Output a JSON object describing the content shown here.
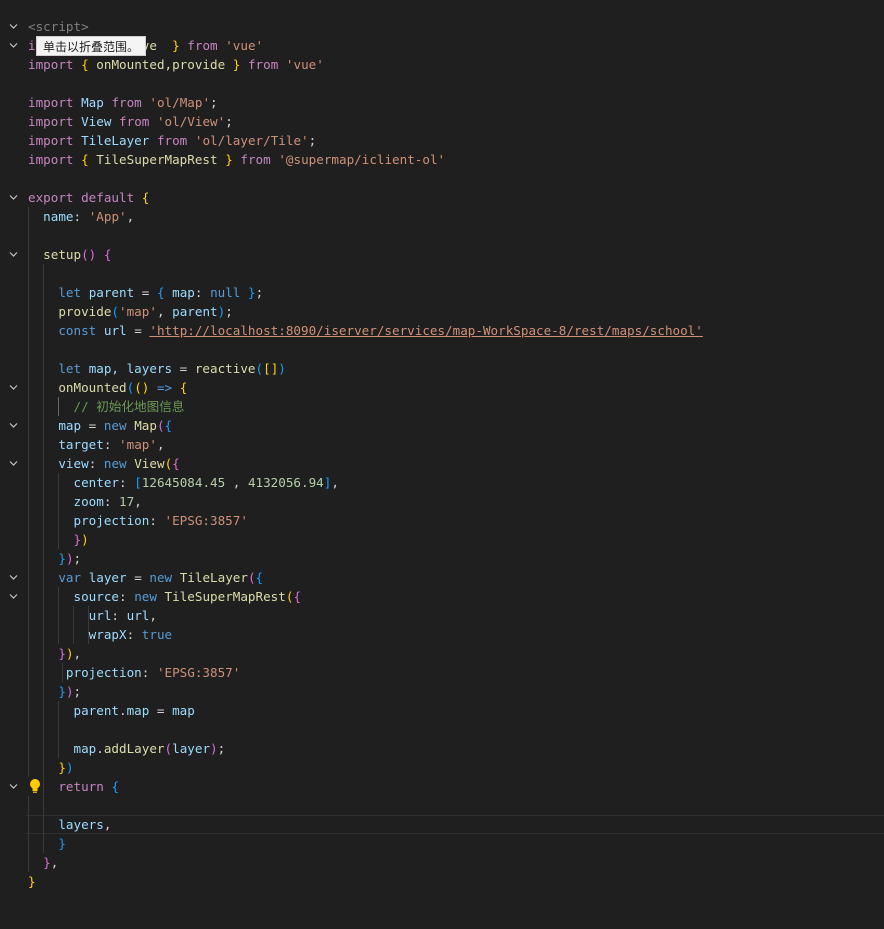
{
  "tooltip": {
    "text": "单击以折叠范围。"
  },
  "code": {
    "l1": {
      "open": "<script>"
    },
    "l2": {
      "kw_import": "i",
      "hidden": "",
      "end": "ve",
      "close": "}",
      "kw_from": "from",
      "str": "'vue'"
    },
    "l3": {
      "kw": "import",
      "open": "{",
      "names": "onMounted,provide",
      "close": "}",
      "kw_from": "from",
      "str": "'vue'"
    },
    "l5": {
      "kw": "import",
      "name": "Map",
      "kw_from": "from",
      "str": "'ol/Map'",
      "semi": ";"
    },
    "l6": {
      "kw": "import",
      "name": "View",
      "kw_from": "from",
      "str": "'ol/View'",
      "semi": ";"
    },
    "l7": {
      "kw": "import",
      "name": "TileLayer",
      "kw_from": "from",
      "str": "'ol/layer/Tile'",
      "semi": ";"
    },
    "l8": {
      "kw": "import",
      "open": "{",
      "name": "TileSuperMapRest",
      "close": "}",
      "kw_from": "from",
      "str": "'@supermap/iclient-ol'"
    },
    "l10": {
      "kw_export": "export",
      "kw_default": "default",
      "open": "{"
    },
    "l11": {
      "prop": "name",
      "colon": ":",
      "str": "'App'",
      "comma": ","
    },
    "l13": {
      "fn": "setup",
      "parens": "()",
      "open": "{"
    },
    "l15": {
      "kw": "let",
      "var": "parent",
      "eq": " = ",
      "open": "{",
      "prop": "map",
      "colon": ":",
      "null": "null",
      "close": "}",
      "semi": ";"
    },
    "l16": {
      "fn": "provide",
      "open": "(",
      "str": "'map'",
      "comma": ", ",
      "var": "parent",
      "close": ")",
      "semi": ";"
    },
    "l17": {
      "kw": "const",
      "var": "url",
      "eq": " = ",
      "url": "'http://localhost:8090/iserver/services/map-WorkSpace-8/rest/maps/school'"
    },
    "l19": {
      "kw": "let",
      "vars": "map, layers",
      "eq": " = ",
      "fn": "reactive",
      "open": "(",
      "arr": "[]",
      "close": ")"
    },
    "l20": {
      "fn": "onMounted",
      "open": "(",
      "parens": "()",
      "arrow": " => ",
      "brace": "{"
    },
    "l21": {
      "comment": "// 初始化地图信息"
    },
    "l22": {
      "var": "map",
      "eq": " = ",
      "kw_new": "new",
      "cls": "Map",
      "open": "(",
      "brace": "{"
    },
    "l23": {
      "prop": "target",
      "colon": ":",
      "str": "'map'",
      "comma": ","
    },
    "l24": {
      "prop": "view",
      "colon": ":",
      "kw_new": "new",
      "cls": "View",
      "open": "(",
      "brace": "{"
    },
    "l25": {
      "prop": "center",
      "colon": ":",
      "open": "[",
      "num1": "12645084.45",
      "sep": " , ",
      "num2": "4132056.94",
      "close": "]",
      "comma": ","
    },
    "l26": {
      "prop": "zoom",
      "colon": ":",
      "num": "17",
      "comma": ","
    },
    "l27": {
      "prop": "projection",
      "colon": ":",
      "str": "'EPSG:3857'"
    },
    "l28": {
      "brace": "}",
      "paren": ")"
    },
    "l29": {
      "brace": "}",
      "paren": ")",
      "semi": ";"
    },
    "l30": {
      "kw": "var",
      "var": "layer",
      "eq": " = ",
      "kw_new": "new",
      "cls": "TileLayer",
      "open": "(",
      "brace": "{"
    },
    "l31": {
      "prop": "source",
      "colon": ":",
      "kw_new": "new",
      "cls": "TileSuperMapRest",
      "open": "(",
      "brace": "{"
    },
    "l32": {
      "prop": "url",
      "colon": ":",
      "var": "url",
      "comma": ","
    },
    "l33": {
      "prop": "wrapX",
      "colon": ":",
      "bool": "true"
    },
    "l34": {
      "brace": "}",
      "paren": ")",
      "comma": ","
    },
    "l35": {
      "prop": "projection",
      "colon": ":",
      "str": "'EPSG:3857'"
    },
    "l36": {
      "brace": "}",
      "paren": ")",
      "semi": ";"
    },
    "l37": {
      "obj": "parent",
      "dot": ".",
      "prop": "map",
      "eq": " = ",
      "var": "map"
    },
    "l39": {
      "obj": "map",
      "dot": ".",
      "fn": "addLayer",
      "open": "(",
      "var": "layer",
      "close": ")",
      "semi": ";"
    },
    "l40": {
      "brace": "}",
      "paren": ")"
    },
    "l41": {
      "kw": "return",
      "brace": "{"
    },
    "l43": {
      "var": "layers",
      "comma": ","
    },
    "l44": {
      "brace": "}"
    },
    "l45": {
      "brace": "}",
      "comma": ","
    },
    "l46": {
      "brace": "}"
    }
  },
  "colors": {
    "background": "#1f1f1f",
    "keyword": "#569cd6",
    "control": "#c586c0",
    "string": "#ce9178",
    "variable": "#9cdcfe",
    "function": "#dcdcaa",
    "number": "#b5cea8",
    "comment": "#6a9955",
    "bracket1": "#ffd700",
    "bracket2": "#da70d6",
    "bracket3": "#179fff"
  },
  "icons": {
    "fold": "chevron-down-icon",
    "hint": "lightbulb-icon"
  }
}
